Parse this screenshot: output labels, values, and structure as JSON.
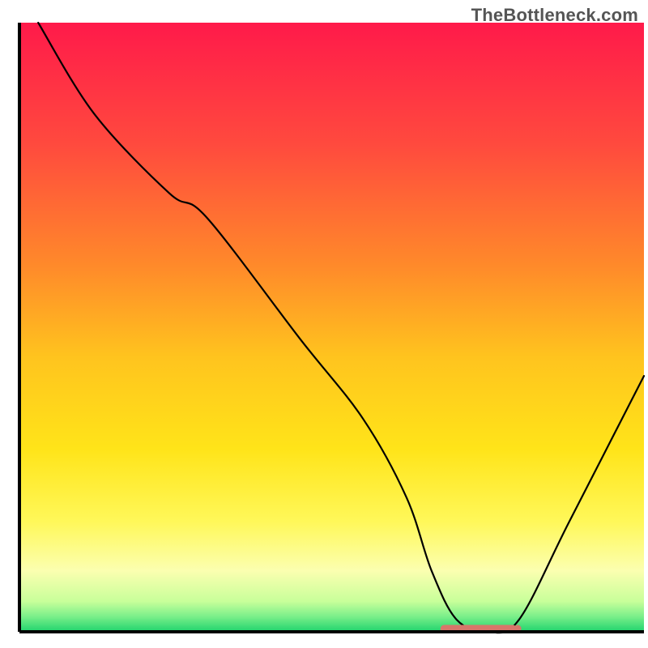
{
  "watermark": "TheBottleneck.com",
  "chart_data": {
    "type": "line",
    "title": "",
    "xlabel": "",
    "ylabel": "",
    "xlim": [
      0,
      100
    ],
    "ylim": [
      0,
      100
    ],
    "x": [
      3,
      12,
      24,
      30,
      45,
      55,
      62,
      66,
      70,
      75,
      80,
      88,
      100
    ],
    "values": [
      100,
      85,
      72,
      68,
      48,
      35,
      22,
      10,
      2,
      0,
      2,
      18,
      42
    ],
    "annotations": [
      {
        "type": "flat-marker",
        "x_start": 68,
        "x_end": 79,
        "y": 0,
        "color": "#d7766a"
      }
    ],
    "background_gradient": {
      "stops": [
        {
          "offset": 0.0,
          "color": "#ff1a4a"
        },
        {
          "offset": 0.2,
          "color": "#ff4a3e"
        },
        {
          "offset": 0.4,
          "color": "#ff8a2a"
        },
        {
          "offset": 0.55,
          "color": "#ffc41e"
        },
        {
          "offset": 0.7,
          "color": "#ffe419"
        },
        {
          "offset": 0.82,
          "color": "#fff85a"
        },
        {
          "offset": 0.9,
          "color": "#fbffb0"
        },
        {
          "offset": 0.95,
          "color": "#c8ff9a"
        },
        {
          "offset": 0.975,
          "color": "#7aef8a"
        },
        {
          "offset": 1.0,
          "color": "#1fd36d"
        }
      ]
    },
    "axes": {
      "left": true,
      "bottom": true,
      "top": false,
      "right": false
    }
  }
}
